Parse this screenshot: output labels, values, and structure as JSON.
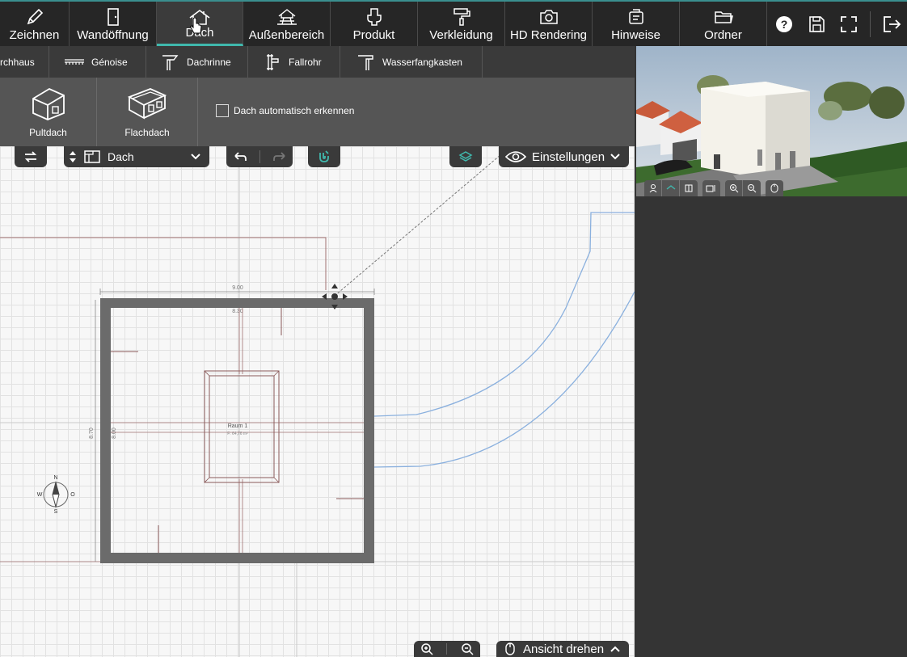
{
  "toolbar": {
    "items": [
      {
        "label": "Zeichnen",
        "icon": "pencil-icon"
      },
      {
        "label": "Wandöffnung",
        "icon": "door-icon"
      },
      {
        "label": "Dach",
        "icon": "roof-icon",
        "active": true
      },
      {
        "label": "Außenbereich",
        "icon": "terrain-icon"
      },
      {
        "label": "Produkt",
        "icon": "toilet-icon"
      },
      {
        "label": "Verkleidung",
        "icon": "paint-roller-icon"
      },
      {
        "label": "HD Rendering",
        "icon": "camera-icon"
      },
      {
        "label": "Hinweise",
        "icon": "notes-icon"
      },
      {
        "label": "Ordner",
        "icon": "folder-icon"
      }
    ],
    "help_icon": "?"
  },
  "subbar": {
    "items": [
      {
        "label": "rchhaus"
      },
      {
        "label": "Génoise"
      },
      {
        "label": "Dachrinne"
      },
      {
        "label": "Fallrohr"
      },
      {
        "label": "Wasserfangkasten"
      }
    ]
  },
  "roofpanel": {
    "cards": [
      {
        "label": "Pultdach"
      },
      {
        "label": "Flachdach"
      }
    ],
    "auto_detect_label": "Dach automatisch erkennen"
  },
  "canvas": {
    "level_select": "Dach",
    "settings_label": "Einstellungen",
    "rotate_label": "Ansicht drehen",
    "room_name": "Raum 1",
    "room_area": "F: 64,76 m²",
    "dim_width": "9.00",
    "dim_inner_width": "8.30",
    "dim_height": "8.70",
    "dim_inner_height": "8.00",
    "compass": {
      "n": "N",
      "s": "S",
      "w": "W",
      "o": "O"
    }
  },
  "colors": {
    "accent": "#40b8ad",
    "toolbar_bg": "#262626",
    "panel_bg": "#555555",
    "wall": "#6b6b6b"
  }
}
